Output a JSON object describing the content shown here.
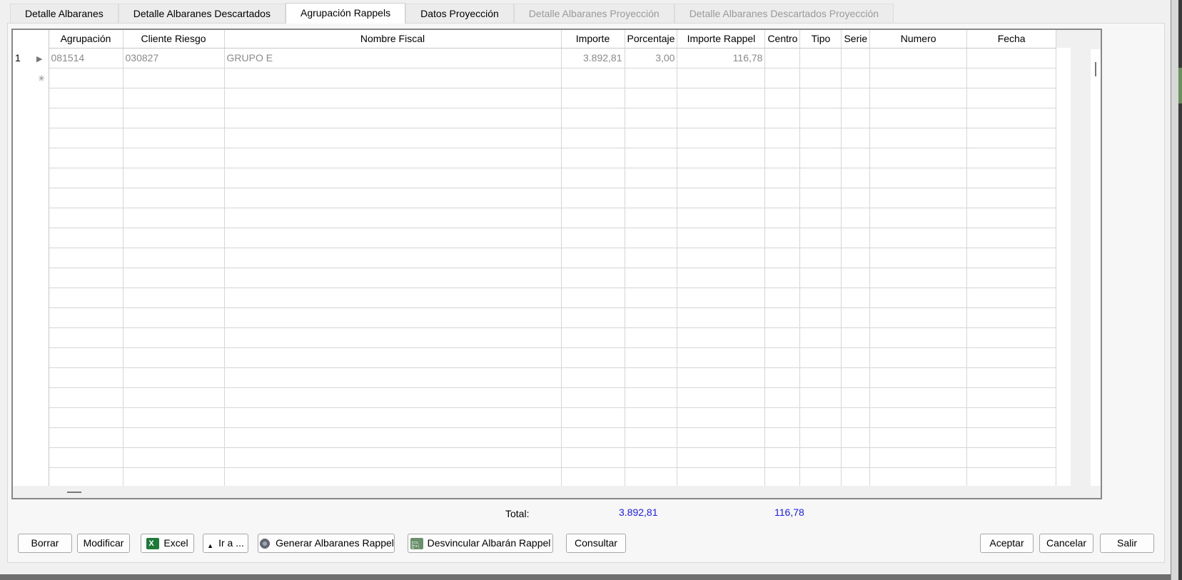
{
  "tabs": [
    {
      "label": "Detalle Albaranes",
      "state": "normal"
    },
    {
      "label": "Detalle Albaranes Descartados",
      "state": "normal"
    },
    {
      "label": "Agrupación Rappels",
      "state": "active"
    },
    {
      "label": "Datos Proyección",
      "state": "normal"
    },
    {
      "label": "Detalle Albaranes Proyección",
      "state": "disabled"
    },
    {
      "label": "Detalle Albaranes Descartados Proyección",
      "state": "disabled"
    }
  ],
  "grid": {
    "columns": [
      "Agrupación",
      "Cliente Riesgo",
      "Nombre Fiscal",
      "Importe",
      "Porcentaje",
      "Importe Rappel",
      "Centro",
      "Tipo",
      "Serie",
      "Numero",
      "Fecha"
    ],
    "rows": [
      {
        "row_number": "1",
        "cells": [
          "081514",
          "030827",
          "GRUPO E",
          "3.892,81",
          "3,00",
          "116,78",
          "",
          "",
          "",
          "",
          ""
        ]
      }
    ],
    "new_row_marker": "✳"
  },
  "totals": {
    "label": "Total:",
    "importe": "3.892,81",
    "importe_rappel": "116,78"
  },
  "buttons": {
    "borrar": "Borrar",
    "modificar": "Modificar",
    "excel": "Excel",
    "ir_a": "Ir a ...",
    "generar": "Generar Albaranes Rappel",
    "desvincular": "Desvincular Albarán Rappel",
    "consultar": "Consultar",
    "aceptar": "Aceptar",
    "cancelar": "Cancelar",
    "salir": "Salir"
  },
  "colors": {
    "total_value": "#1a1aff",
    "cell_text": "#8a8a8a"
  },
  "icons": [
    "excel-icon",
    "arrow-up-icon",
    "gear-icon",
    "unlink-icon",
    "row-indicator-icon",
    "new-row-icon"
  ]
}
